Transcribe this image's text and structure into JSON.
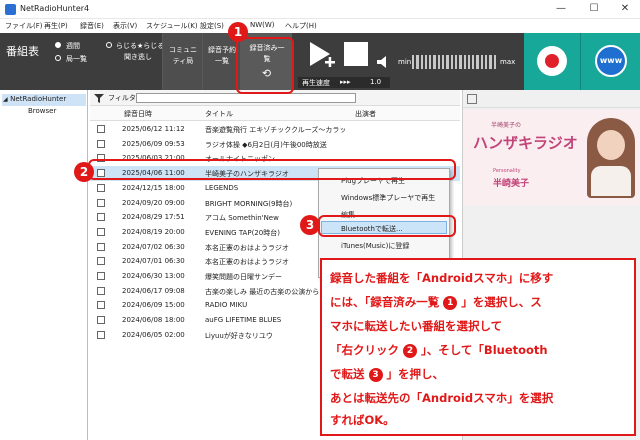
{
  "window": {
    "title": "NetRadioHunter4",
    "minimize": "—",
    "maximize": "☐",
    "close": "✕"
  },
  "menu": [
    "ファイル(F)",
    "再生(P)",
    "録音(E)",
    "表示(V)",
    "スケジュール(K)",
    "設定(S)",
    "NW(W)",
    "ヘルプ(H)"
  ],
  "toolbar": {
    "program_table": "番組表",
    "weekly": "週間",
    "station_list": "局一覧",
    "radiru": "らじる★らじる",
    "missed": "聞き逃し",
    "community": "コミュニティ局",
    "reservations": "録音予約一覧",
    "recorded": "録音済み一覧",
    "playback_speed": "再生速度",
    "speed_value": "1.0",
    "vol_min": "min",
    "vol_max": "max",
    "www": "www"
  },
  "tree": {
    "root": "NetRadioHunter",
    "child": "Browser"
  },
  "list": {
    "filter_label": "フィルタ",
    "columns": [
      "録音日時",
      "タイトル",
      "出演者"
    ],
    "rows": [
      {
        "date": "2025/06/12 11:12",
        "title": "音楽遊覧飛行 エキゾチッククルーズ〜カラッと…",
        "performer": "",
        "selected": false
      },
      {
        "date": "2025/06/09 09:53",
        "title": "ラジオ体操 ◆6月2日(月)午後00時放送",
        "performer": "",
        "selected": false
      },
      {
        "date": "2025/06/03 21:00",
        "title": "オールナイトニッポン",
        "performer": "",
        "selected": false
      },
      {
        "date": "2025/04/06 11:00",
        "title": "半崎美子のハンザキラジオ",
        "performer": "半崎美子",
        "selected": true
      },
      {
        "date": "2024/12/15 18:00",
        "title": "LEGENDS",
        "performer": "",
        "selected": false
      },
      {
        "date": "2024/09/20 09:00",
        "title": "BRIGHT MORNING(9時台)",
        "performer": "",
        "selected": false
      },
      {
        "date": "2024/08/29 17:51",
        "title": "アコム Somethin'New",
        "performer": "",
        "selected": false
      },
      {
        "date": "2024/08/19 20:00",
        "title": "EVENING TAP(20時台)",
        "performer": "",
        "selected": false
      },
      {
        "date": "2024/07/02 06:30",
        "title": "本名正憲のおはようラジオ",
        "performer": "",
        "selected": false
      },
      {
        "date": "2024/07/01 06:30",
        "title": "本名正憲のおはようラジオ",
        "performer": "",
        "selected": false
      },
      {
        "date": "2024/06/30 13:00",
        "title": "爆笑問題の日曜サンデー",
        "performer": "",
        "selected": false
      },
      {
        "date": "2024/06/17 09:08",
        "title": "古楽の楽しみ 最近の古楽の公演から",
        "performer": "",
        "selected": false
      },
      {
        "date": "2024/06/09 15:00",
        "title": "RADIO MIKU",
        "performer": "",
        "selected": false
      },
      {
        "date": "2024/06/08 18:00",
        "title": "auFG LIFETIME BLUES",
        "performer": "",
        "selected": false
      },
      {
        "date": "2024/06/05 02:00",
        "title": "Liyuuが好きなリユウ",
        "performer": "",
        "selected": false
      }
    ]
  },
  "context_menu": {
    "items": [
      "Plugプレーヤで再生",
      "Windows標準プレーヤで再生",
      "編集",
      "Bluetoothで転送...",
      "iTunes(Music)に登録",
      "削除"
    ]
  },
  "banner": {
    "small_caption": "半崎美子の",
    "title": "ハンザキラジオ",
    "personality_label": "Personality",
    "personality_name": "半崎美子"
  },
  "badges": [
    "1",
    "2",
    "3"
  ],
  "callout": {
    "line1": "録音した番組を「Androidスマホ」に移す",
    "line2a": "には、「録音済み一覧",
    "line2b": "」を選択し、ス",
    "line3": "マホに転送したい番組を選択して",
    "line4a": "「右クリック",
    "line4b": "」、そして「Bluetooth",
    "line5a": "で転送",
    "line5b": "」を押し、",
    "line6": "あとは転送先の「Androidスマホ」を選択",
    "line7": "すればOK。"
  },
  "colors": {
    "accent_red": "#e01818",
    "toolbar_bg": "#3d3d3d",
    "teal": "#18a89a",
    "selection": "#cde4f7"
  }
}
